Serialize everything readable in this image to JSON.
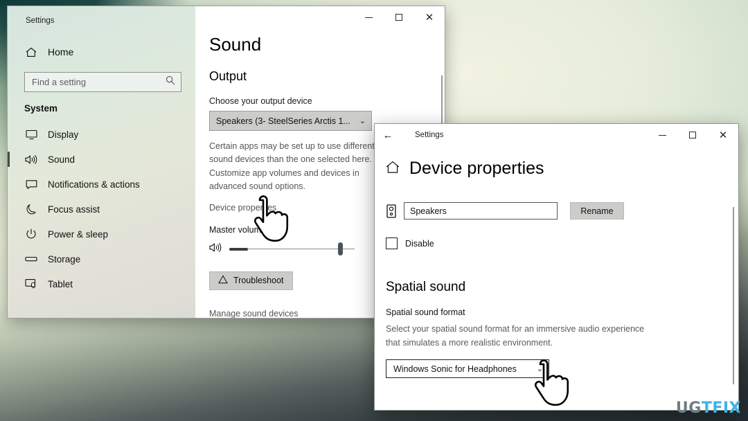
{
  "desktop": {
    "watermark_left": "UG",
    "watermark_right": "TFIX"
  },
  "sound_window": {
    "titlebar": {
      "title": "Settings",
      "minimize": "–",
      "maximize": "□",
      "close": "✕"
    },
    "sidebar": {
      "home": "Home",
      "search_placeholder": "Find a setting",
      "search_value": "",
      "section": "System",
      "items": [
        {
          "label": "Display",
          "icon": "monitor-icon",
          "selected": false
        },
        {
          "label": "Sound",
          "icon": "speaker-icon",
          "selected": true
        },
        {
          "label": "Notifications & actions",
          "icon": "notification-icon",
          "selected": false
        },
        {
          "label": "Focus assist",
          "icon": "moon-icon",
          "selected": false
        },
        {
          "label": "Power & sleep",
          "icon": "power-icon",
          "selected": false
        },
        {
          "label": "Storage",
          "icon": "storage-icon",
          "selected": false
        },
        {
          "label": "Tablet",
          "icon": "tablet-icon",
          "selected": false
        }
      ]
    },
    "pane": {
      "heading": "Sound",
      "output_heading": "Output",
      "choose_device_label": "Choose your output device",
      "output_device_value": "Speakers (3- SteelSeries Arctis 1...",
      "chevron": "⌄",
      "note": "Certain apps may be set up to use different sound devices than the one selected here. Customize app volumes and devices in advanced sound options.",
      "device_properties_link": "Device properties",
      "master_volume_label": "Master volume",
      "master_volume_value": 87,
      "troubleshoot_label": "Troubleshoot",
      "troubleshoot_icon": "warning-triangle-icon",
      "manage_devices_link": "Manage sound devices"
    }
  },
  "device_properties_window": {
    "titlebar": {
      "back": "←",
      "title": "Settings",
      "minimize": "–",
      "maximize": "□",
      "close": "✕"
    },
    "heading": "Device properties",
    "home_icon": "home-icon",
    "device_name_value": "Speakers",
    "device_name_icon": "speaker-cabinet-icon",
    "rename_button": "Rename",
    "disable_label": "Disable",
    "disable_checked": false,
    "spatial": {
      "heading": "Spatial sound",
      "format_label": "Spatial sound format",
      "description": "Select your spatial sound format for an immersive audio experience that simulates a more realistic environment.",
      "format_value": "Windows Sonic for Headphones",
      "chevron": "⌄"
    }
  }
}
